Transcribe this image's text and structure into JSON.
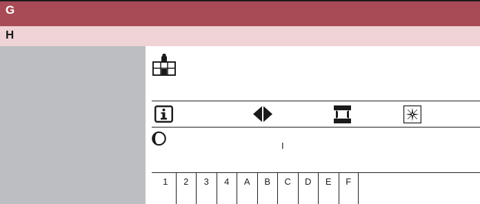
{
  "header": {
    "title": "G",
    "subtitle": "H"
  },
  "toolbar": {
    "icons": [
      "workstation-icon",
      "info-icon",
      "left-right-arrows-icon",
      "clamp-icon",
      "compass-star-icon",
      "half-moon-icon"
    ]
  },
  "indicator": {
    "value": "I"
  },
  "keypad": {
    "keys": [
      "1",
      "2",
      "3",
      "4",
      "A",
      "B",
      "C",
      "D",
      "E",
      "F"
    ]
  },
  "colors": {
    "title_bar": "#a84b56",
    "subtitle_bar": "#f0d3d6",
    "sidebar": "#bcbec1",
    "ink": "#1a1a1a"
  }
}
